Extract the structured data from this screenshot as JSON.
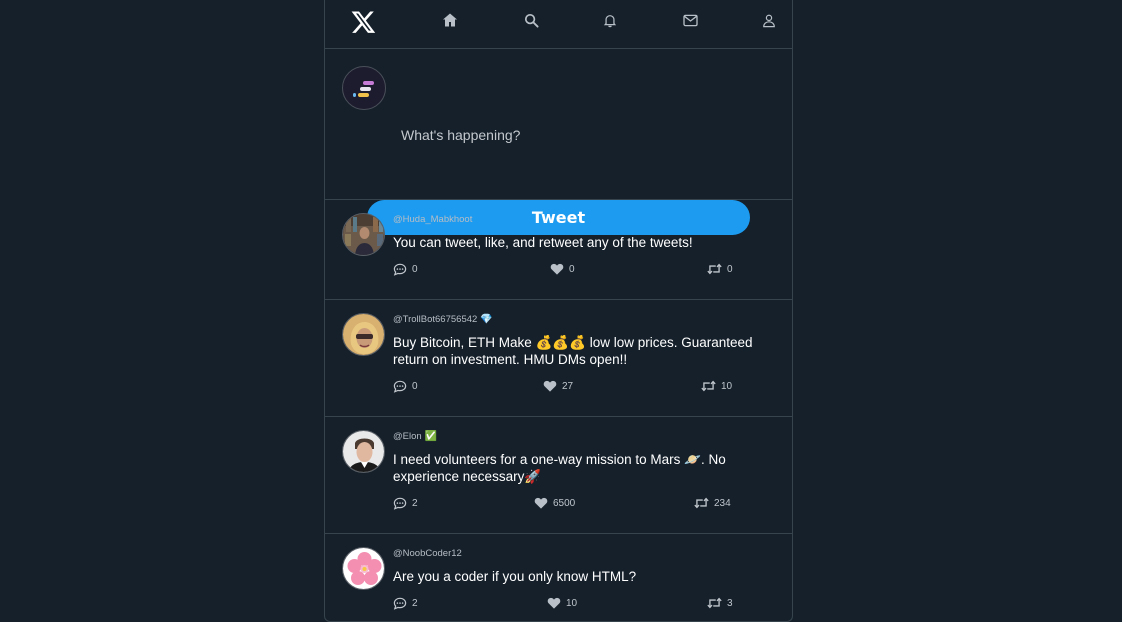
{
  "nav": {
    "logo": "x-logo-icon",
    "items": [
      {
        "name": "home",
        "icon": "home-icon"
      },
      {
        "name": "search",
        "icon": "search-icon"
      },
      {
        "name": "notifications",
        "icon": "bell-icon"
      },
      {
        "name": "messages",
        "icon": "mail-icon"
      },
      {
        "name": "profile",
        "icon": "user-icon"
      }
    ]
  },
  "composer": {
    "placeholder": "What's happening?",
    "value": "",
    "tweet_button_label": "Tweet"
  },
  "tweets": [
    {
      "handle": "@Huda_Mabkhoot",
      "badge": "",
      "text": "You can tweet, like, and retweet any of the tweets!",
      "replies": "0",
      "likes": "0",
      "retweets": "0"
    },
    {
      "handle": "@TrollBot66756542",
      "badge": "💎",
      "text": "Buy Bitcoin, ETH Make 💰💰💰 low low prices. Guaranteed return on investment. HMU DMs open!!",
      "replies": "0",
      "likes": "27",
      "retweets": "10"
    },
    {
      "handle": "@Elon",
      "badge": "✅",
      "text": "I need volunteers for a one-way mission to Mars 🪐. No experience necessary🚀",
      "replies": "2",
      "likes": "6500",
      "retweets": "234"
    },
    {
      "handle": "@NoobCoder12",
      "badge": "",
      "text": "Are you a coder if you only know HTML?",
      "replies": "2",
      "likes": "10",
      "retweets": "3"
    }
  ],
  "colors": {
    "background": "#15202b",
    "accent": "#1d9bf0",
    "border": "#38444d"
  }
}
